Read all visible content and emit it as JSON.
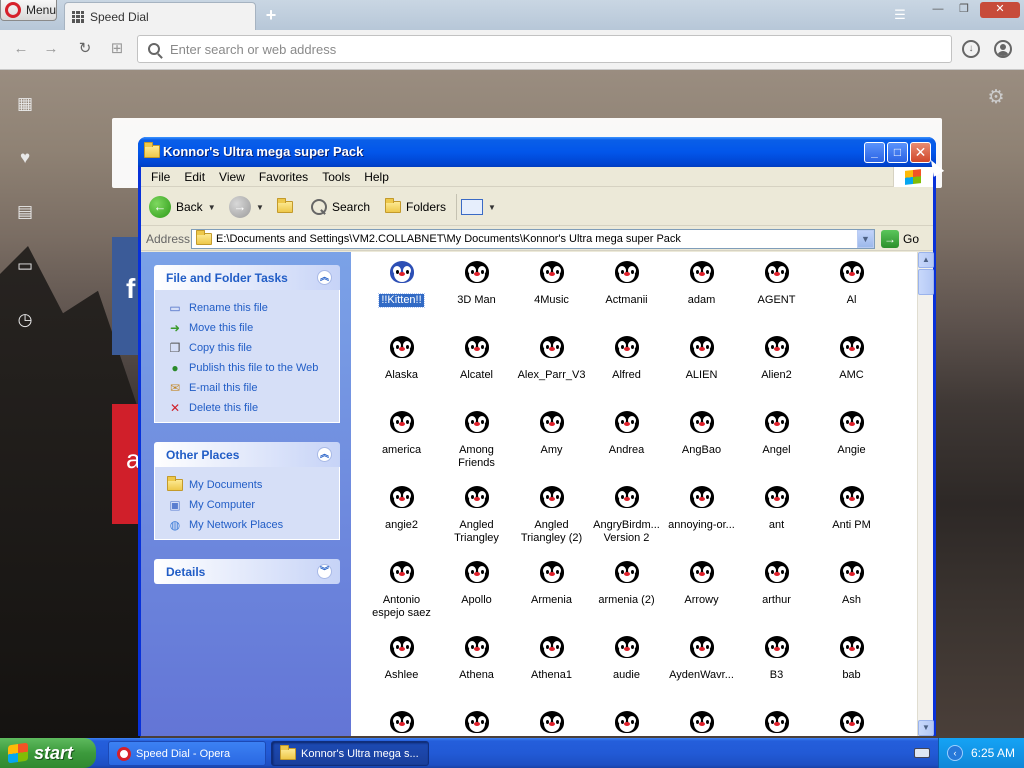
{
  "browser": {
    "menu_label": "Menu",
    "tab_title": "Speed Dial",
    "new_tab": "+",
    "address_placeholder": "Enter search or web address",
    "icons": [
      "opera-logo-icon",
      "back-icon",
      "forward-icon",
      "reload-icon",
      "speed-dial-grid-icon",
      "search-icon",
      "download-icon",
      "account-icon"
    ]
  },
  "speed_dial": {
    "sidebar_icons": [
      "speed-dial-icon",
      "heart-icon",
      "news-icon",
      "devices-icon",
      "history-icon"
    ],
    "tile_fb_letter": "f",
    "tile_red_letter": "a"
  },
  "explorer": {
    "title": "Konnor's Ultra mega super Pack",
    "menu": [
      "File",
      "Edit",
      "View",
      "Favorites",
      "Tools",
      "Help"
    ],
    "toolbar": {
      "back": "Back",
      "search": "Search",
      "folders": "Folders"
    },
    "address_label": "Address",
    "address_value": "E:\\Documents and Settings\\VM2.COLLABNET\\My Documents\\Konnor's Ultra mega super Pack",
    "go_label": "Go",
    "tasks": {
      "file_folder": {
        "header": "File and Folder Tasks",
        "items": [
          "Rename this file",
          "Move this file",
          "Copy this file",
          "Publish this file to the Web",
          "E-mail this file",
          "Delete this file"
        ]
      },
      "other_places": {
        "header": "Other Places",
        "items": [
          "My Documents",
          "My Computer",
          "My Network Places"
        ]
      },
      "details": {
        "header": "Details"
      }
    },
    "files": [
      "!!Kitten!!",
      "3D Man",
      "4Music",
      "Actmanii",
      "adam",
      "AGENT",
      "Al",
      "Alaska",
      "Alcatel",
      "Alex_Parr_V3",
      "Alfred",
      "ALIEN",
      "Alien2",
      "AMC",
      "america",
      "Among Friends",
      "Amy",
      "Andrea",
      "AngBao",
      "Angel",
      "Angie",
      "angie2",
      "Angled Triangley",
      "Angled Triangley (2)",
      "AngryBirdm... Version 2",
      "annoying-or...",
      "ant",
      "Anti PM",
      "Antonio espejo saez",
      "Apollo",
      "Armenia",
      "armenia (2)",
      "Arrowy",
      "arthur",
      "Ash",
      "Ashlee",
      "Athena",
      "Athena1",
      "audie",
      "AydenWavr...",
      "B3",
      "bab",
      "",
      "",
      "",
      "",
      "",
      "",
      ""
    ],
    "selected_file": "!!Kitten!!"
  },
  "taskbar": {
    "start_label": "start",
    "tasks": [
      "Speed Dial - Opera",
      "Konnor's Ultra mega s..."
    ],
    "clock": "6:25 AM"
  }
}
